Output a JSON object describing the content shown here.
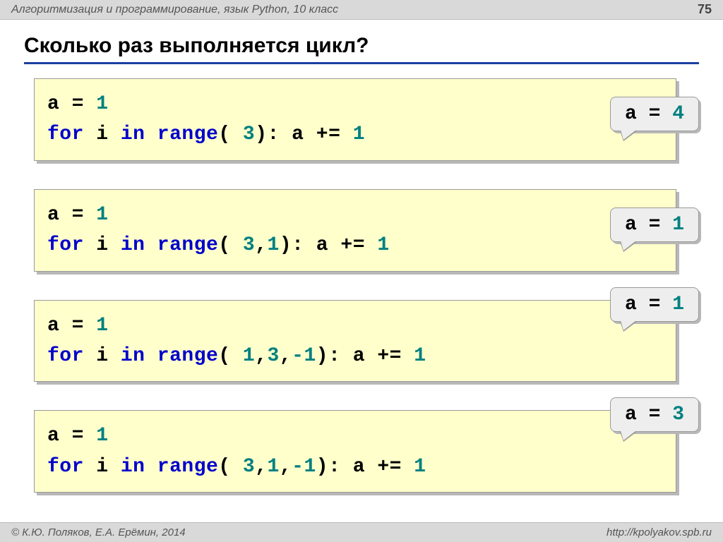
{
  "header": {
    "subject": "Алгоритмизация и программирование, язык Python, 10 класс",
    "page": "75"
  },
  "title": "Сколько раз выполняется цикл?",
  "examples": [
    {
      "line1_lhs": "a",
      "line1_eq": "=",
      "line1_val": "1",
      "kw_for": "for",
      "loop_var": "i",
      "kw_in": "in",
      "kw_range": "range",
      "open": "(",
      "args": [
        {
          "text": " 3",
          "kind": "num"
        }
      ],
      "close": "):",
      "inc_lhs": "a",
      "inc_op": "+=",
      "inc_val": "1",
      "answer_lhs": "a",
      "answer_eq": "=",
      "answer_val": "4",
      "ans_class": "ans-1"
    },
    {
      "line1_lhs": "a",
      "line1_eq": "=",
      "line1_val": "1",
      "kw_for": "for",
      "loop_var": "i",
      "kw_in": "in",
      "kw_range": "range",
      "open": "(",
      "args": [
        {
          "text": " 3",
          "kind": "num"
        },
        {
          "text": ",",
          "kind": "op"
        },
        {
          "text": "1",
          "kind": "num"
        }
      ],
      "close": "):",
      "inc_lhs": "a",
      "inc_op": "+=",
      "inc_val": "1",
      "answer_lhs": "a",
      "answer_eq": "=",
      "answer_val": "1",
      "ans_class": "ans-2"
    },
    {
      "line1_lhs": "a",
      "line1_eq": "=",
      "line1_val": "1",
      "kw_for": "for",
      "loop_var": "i",
      "kw_in": "in",
      "kw_range": "range",
      "open": "(",
      "args": [
        {
          "text": " 1",
          "kind": "num"
        },
        {
          "text": ",",
          "kind": "op"
        },
        {
          "text": "3",
          "kind": "num"
        },
        {
          "text": ",",
          "kind": "op"
        },
        {
          "text": "-1",
          "kind": "num"
        }
      ],
      "close": "):",
      "inc_lhs": "a",
      "inc_op": "+=",
      "inc_val": "1",
      "answer_lhs": "a",
      "answer_eq": "=",
      "answer_val": "1",
      "ans_class": "ans-3"
    },
    {
      "line1_lhs": "a",
      "line1_eq": "=",
      "line1_val": "1",
      "kw_for": "for",
      "loop_var": "i",
      "kw_in": "in",
      "kw_range": "range",
      "open": "(",
      "args": [
        {
          "text": " 3",
          "kind": "num"
        },
        {
          "text": ",",
          "kind": "op"
        },
        {
          "text": "1",
          "kind": "num"
        },
        {
          "text": ",",
          "kind": "op"
        },
        {
          "text": "-1",
          "kind": "num"
        }
      ],
      "close": "):",
      "inc_lhs": "a",
      "inc_op": "+=",
      "inc_val": "1",
      "answer_lhs": "a",
      "answer_eq": "=",
      "answer_val": "3",
      "ans_class": "ans-4"
    }
  ],
  "footer": {
    "copyright": "© К.Ю. Поляков, Е.А. Ерёмин, 2014",
    "url": "http://kpolyakov.spb.ru"
  }
}
